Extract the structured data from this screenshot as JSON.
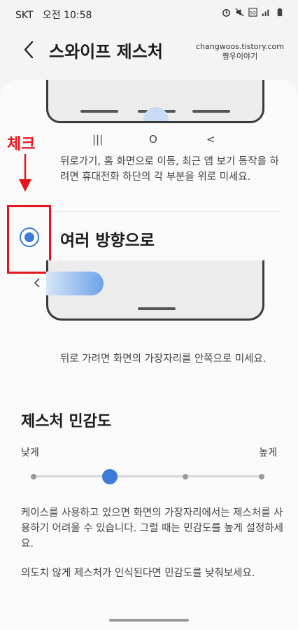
{
  "status_bar": {
    "carrier": "SKT",
    "time": "오전 10:58",
    "icons": [
      "alarm-icon",
      "mute-icon",
      "lte-icon",
      "signal-icon",
      "battery-icon"
    ]
  },
  "app_bar": {
    "back_icon": "chevron-left-icon",
    "title": "스와이프 제스처"
  },
  "watermark": {
    "url": "changwoos.tistory.com",
    "name": "짱우이야기"
  },
  "button_nav_option": {
    "nav_keys": [
      "|||",
      "O",
      "<"
    ],
    "description": "뒤로가기, 홈 화면으로 이동, 최근 앱 보기 동작을 하려면 휴대전화 하단의 각 부분을 위로 미세요."
  },
  "annotation": {
    "label": "체크",
    "color": "#e8141d"
  },
  "gesture_option": {
    "label": "여러 방향으로",
    "selected": true,
    "edge_icon": "chevron-left-icon",
    "description": "뒤로 가려면 화면의 가장자리를 안쪽으로 미세요."
  },
  "sensitivity": {
    "title": "제스처 민감도",
    "low_label": "낮게",
    "high_label": "높게",
    "steps": 4,
    "value_index": 1,
    "accent_color": "#3d7bd8",
    "note_1": "케이스를 사용하고 있으면 화면의 가장자리에서는 제스처를 사용하기 어려울 수 있습니다. 그럴 때는 민감도를 높게 설정하세요.",
    "note_2": "의도치 않게 제스처가 인식된다면 민감도를 낮춰보세요."
  }
}
